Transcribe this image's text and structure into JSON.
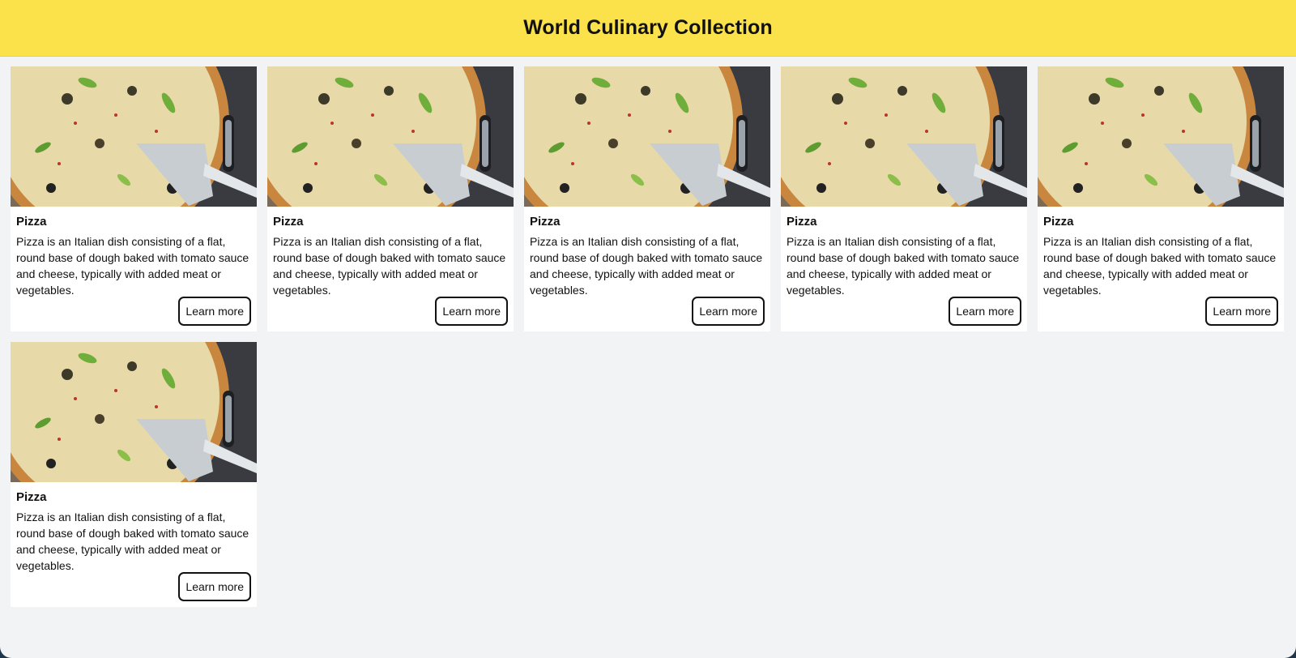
{
  "header": {
    "title": "World Culinary Collection"
  },
  "cards": [
    {
      "title": "Pizza",
      "description": "Pizza is an Italian dish consisting of a flat, round base of dough baked with tomato sauce and cheese, typically with added meat or vegetables.",
      "button_label": "Learn more"
    },
    {
      "title": "Pizza",
      "description": "Pizza is an Italian dish consisting of a flat, round base of dough baked with tomato sauce and cheese, typically with added meat or vegetables.",
      "button_label": "Learn more"
    },
    {
      "title": "Pizza",
      "description": "Pizza is an Italian dish consisting of a flat, round base of dough baked with tomato sauce and cheese, typically with added meat or vegetables.",
      "button_label": "Learn more"
    },
    {
      "title": "Pizza",
      "description": "Pizza is an Italian dish consisting of a flat, round base of dough baked with tomato sauce and cheese, typically with added meat or vegetables.",
      "button_label": "Learn more"
    },
    {
      "title": "Pizza",
      "description": "Pizza is an Italian dish consisting of a flat, round base of dough baked with tomato sauce and cheese, typically with added meat or vegetables.",
      "button_label": "Learn more"
    },
    {
      "title": "Pizza",
      "description": "Pizza is an Italian dish consisting of a flat, round base of dough baked with tomato sauce and cheese, typically with added meat or vegetables.",
      "button_label": "Learn more"
    }
  ],
  "colors": {
    "header_bg": "#fbe14a",
    "page_bg": "#f1f3f5",
    "card_bg": "#ffffff",
    "text": "#111111"
  }
}
